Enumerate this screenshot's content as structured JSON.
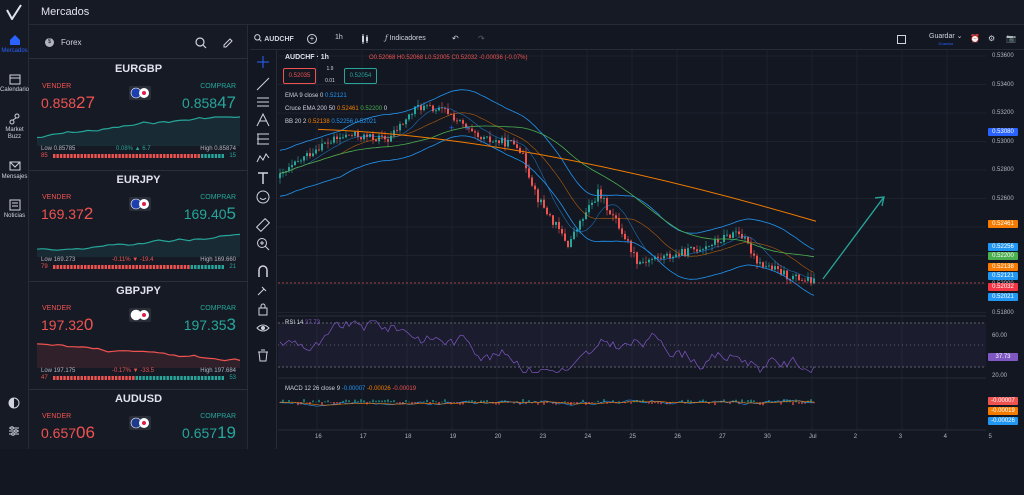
{
  "app": {
    "title": "Mercados"
  },
  "rail": [
    {
      "label": "Mercados",
      "icon": "home-icon",
      "active": true
    },
    {
      "label": "Calendario",
      "icon": "calendar-icon"
    },
    {
      "label": "Market Buzz",
      "icon": "network-icon"
    },
    {
      "label": "Mensajes",
      "icon": "mail-icon"
    },
    {
      "label": "Noticias",
      "icon": "news-icon"
    }
  ],
  "panel": {
    "tab": "Forex"
  },
  "cards": [
    {
      "pair": "EURGBP",
      "sell_label": "VENDER",
      "buy_label": "COMPRAR",
      "sell_main": "0.858",
      "sell_big": "27",
      "buy_main": "0.858",
      "buy_big": "47",
      "low": "Low 0.85785",
      "change": "0.08% ▲ 6.7",
      "high": "High 0.85874",
      "vol_sell": "85",
      "vol_buy": "15",
      "sell_share": 0.85,
      "trend": "up",
      "flag": "eurgbp"
    },
    {
      "pair": "EURJPY",
      "sell_label": "VENDER",
      "buy_label": "COMPRAR",
      "sell_main": "169.37",
      "sell_big": "2",
      "buy_main": "169.40",
      "buy_big": "5",
      "low": "Low 169.273",
      "change": "-0.11% ▼ -19.4",
      "high": "High 169.660",
      "vol_sell": "79",
      "vol_buy": "21",
      "sell_share": 0.79,
      "trend": "up",
      "flag": "eurjpy"
    },
    {
      "pair": "GBPJPY",
      "sell_label": "VENDER",
      "buy_label": "COMPRAR",
      "sell_main": "197.32",
      "sell_big": "0",
      "buy_main": "197.35",
      "buy_big": "3",
      "low": "Low 197.175",
      "change": "-0.17% ▼ -33.5",
      "high": "High 197.684",
      "vol_sell": "47",
      "vol_buy": "53",
      "sell_share": 0.47,
      "trend": "down",
      "flag": "gbpjpy"
    },
    {
      "pair": "AUDUSD",
      "sell_label": "VENDER",
      "buy_label": "COMPRAR",
      "sell_main": "0.657",
      "sell_big": "06",
      "buy_main": "0.657",
      "buy_big": "19",
      "flag": "audusd"
    }
  ],
  "toolbar": {
    "symbol": "AUDCHF",
    "interval": "1h",
    "indicators": "Indicadores",
    "save": "Guardar",
    "save_sub": "Guardar"
  },
  "legend": {
    "title": "AUDCHF · 1h",
    "ohlc_o": "O0.52068",
    "ohlc_h": "H0.52068",
    "ohlc_l": "L0.52005",
    "ohlc_c": "C0.52032",
    "ohlc_chg": "-0.00036 (-0.07%)",
    "sell_price": "0.52035",
    "spread_top": "1.9",
    "spread_bottom": "0.01",
    "buy_price": "0.52054",
    "ema_label": "EMA 9 close 0",
    "ema_val": "0.52121",
    "cruce_label": "Cruce EMA 200 50",
    "cruce_val1": "0.52461",
    "cruce_val2": "0.52200",
    "cruce_val3": "0",
    "bb_label": "BB 20 2",
    "bb_val1": "0.52138",
    "bb_val2": "0.52256",
    "bb_val3": "0.52021",
    "rsi_label": "RSI 14",
    "rsi_val": "37.73",
    "macd_label": "MACD 12 26 close 9",
    "macd_v1": "-0.00007",
    "macd_v2": "-0.00026",
    "macd_v3": "-0.00019"
  },
  "price_axis": [
    "0.53600",
    "0.53400",
    "0.53200",
    "0.53000",
    "0.52800",
    "0.52600",
    "0.52400",
    "0.52200",
    "0.52000",
    "0.51800"
  ],
  "price_badges": [
    {
      "value": "0.53080",
      "color": "#2962ff"
    },
    {
      "value": "0.52461",
      "color": "#f57c00"
    },
    {
      "value": "0.52256",
      "color": "#2196f3"
    },
    {
      "value": "0.52200",
      "color": "#4caf50"
    },
    {
      "value": "0.52138",
      "color": "#f57c00"
    },
    {
      "value": "0.52121",
      "color": "#2196f3"
    },
    {
      "value": "0.52032",
      "color": "#f23645"
    },
    {
      "value": "0.52021",
      "color": "#2196f3"
    }
  ],
  "rsi_axis": [
    "60.00",
    "20.00"
  ],
  "rsi_badge": "37.73",
  "macd_badges": [
    "-0.00007",
    "-0.00019",
    "-0.00026"
  ],
  "time_axis": [
    "16",
    "17",
    "18",
    "19",
    "20",
    "23",
    "24",
    "25",
    "26",
    "27",
    "30",
    "Jul",
    "2",
    "3",
    "4",
    "5"
  ],
  "colors": {
    "up": "#26a69a",
    "down": "#ef5350",
    "accent": "#2962ff",
    "ema200": "#f57c00",
    "rsi": "#7e57c2"
  }
}
